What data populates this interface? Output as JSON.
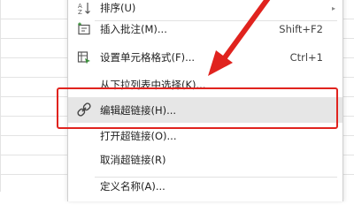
{
  "menu": {
    "items": [
      {
        "label": "排序(U)",
        "icon": "sort-az-icon",
        "has_submenu": true
      },
      {
        "label": "插入批注(M)...",
        "icon": "insert-comment-icon",
        "shortcut": "Shift+F2"
      },
      {
        "label": "设置单元格格式(F)...",
        "icon": "format-cells-icon",
        "shortcut": "Ctrl+1"
      },
      {
        "label": "从下拉列表中选择(K)..."
      },
      {
        "label": "编辑超链接(H)...",
        "icon": "hyperlink-icon",
        "highlighted": true
      },
      {
        "label": "打开超链接(O)..."
      },
      {
        "label": "取消超链接(R)"
      },
      {
        "label": "定义名称(A)..."
      }
    ]
  },
  "annotation": {
    "highlight_color": "#e0231e",
    "arrow_color": "#e0231e"
  },
  "colors": {
    "hover_background": "#e6e6e6",
    "separator": "#e2e2e2"
  }
}
